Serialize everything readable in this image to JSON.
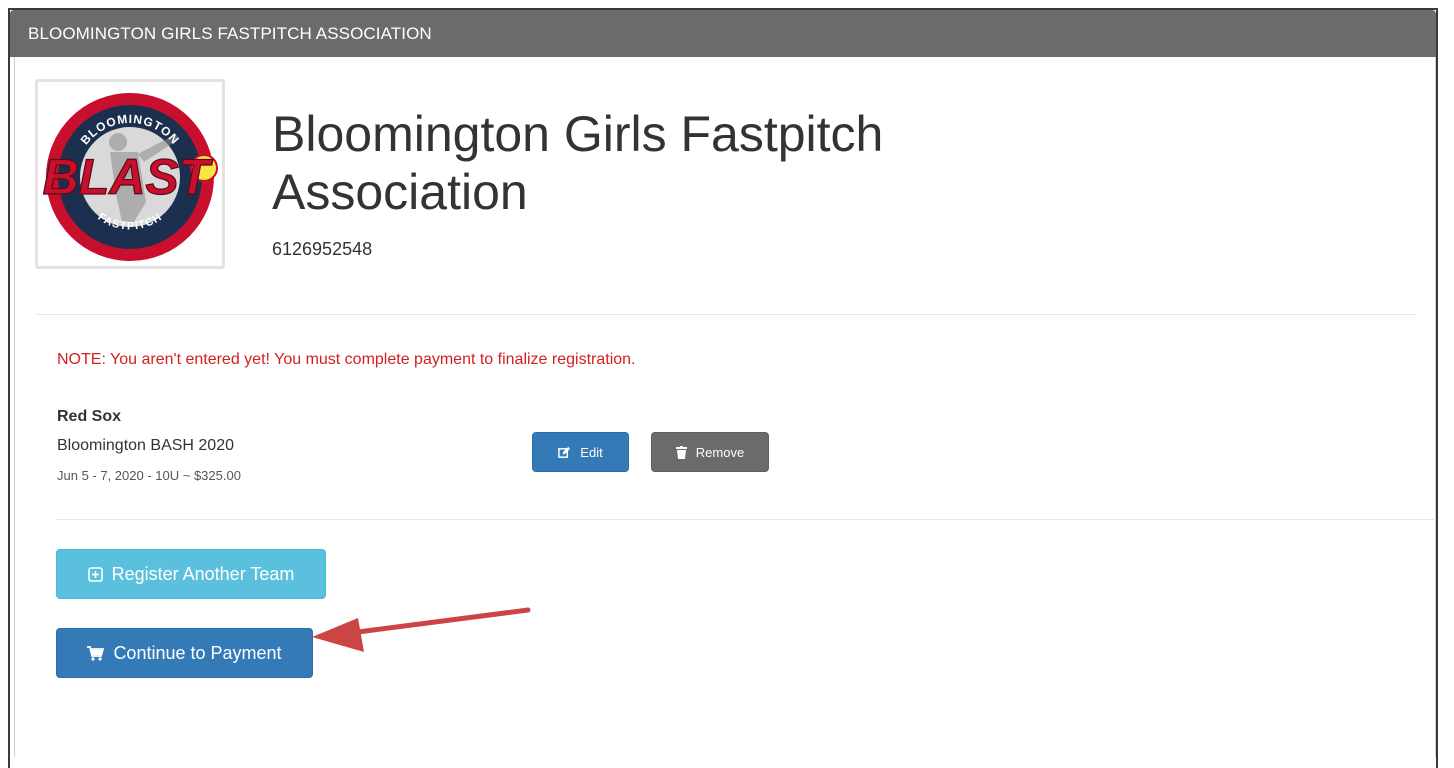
{
  "panel": {
    "header_title": "BLOOMINGTON GIRLS FASTPITCH ASSOCIATION"
  },
  "org": {
    "logo": {
      "icon": "blast-fastpitch-logo",
      "top_text": "BLOOMINGTON",
      "main_text": "BLAST",
      "bottom_text": "FASTPITCH"
    },
    "title": "Bloomington Girls Fastpitch Association",
    "phone": "6126952548"
  },
  "note": "NOTE: You aren't entered yet! You must complete payment to finalize registration.",
  "registration": {
    "team": "Red Sox",
    "event": "Bloomington BASH 2020",
    "details": "Jun 5 - 7, 2020 - 10U ~ $325.00",
    "edit_label": "Edit",
    "remove_label": "Remove"
  },
  "actions": {
    "register_label": "Register Another Team",
    "payment_label": "Continue to Payment"
  },
  "colors": {
    "header_bg": "#6b6b6b",
    "note": "#d21f1f",
    "primary": "#337ab7",
    "info": "#5bc0de",
    "secondary": "#6b6b6b",
    "annotation_arrow": "#cc4444"
  },
  "icons": {
    "edit": "edit-icon",
    "remove": "trash-icon",
    "register": "plus-square-icon",
    "payment": "shopping-cart-icon",
    "annotation": "red-arrow"
  }
}
